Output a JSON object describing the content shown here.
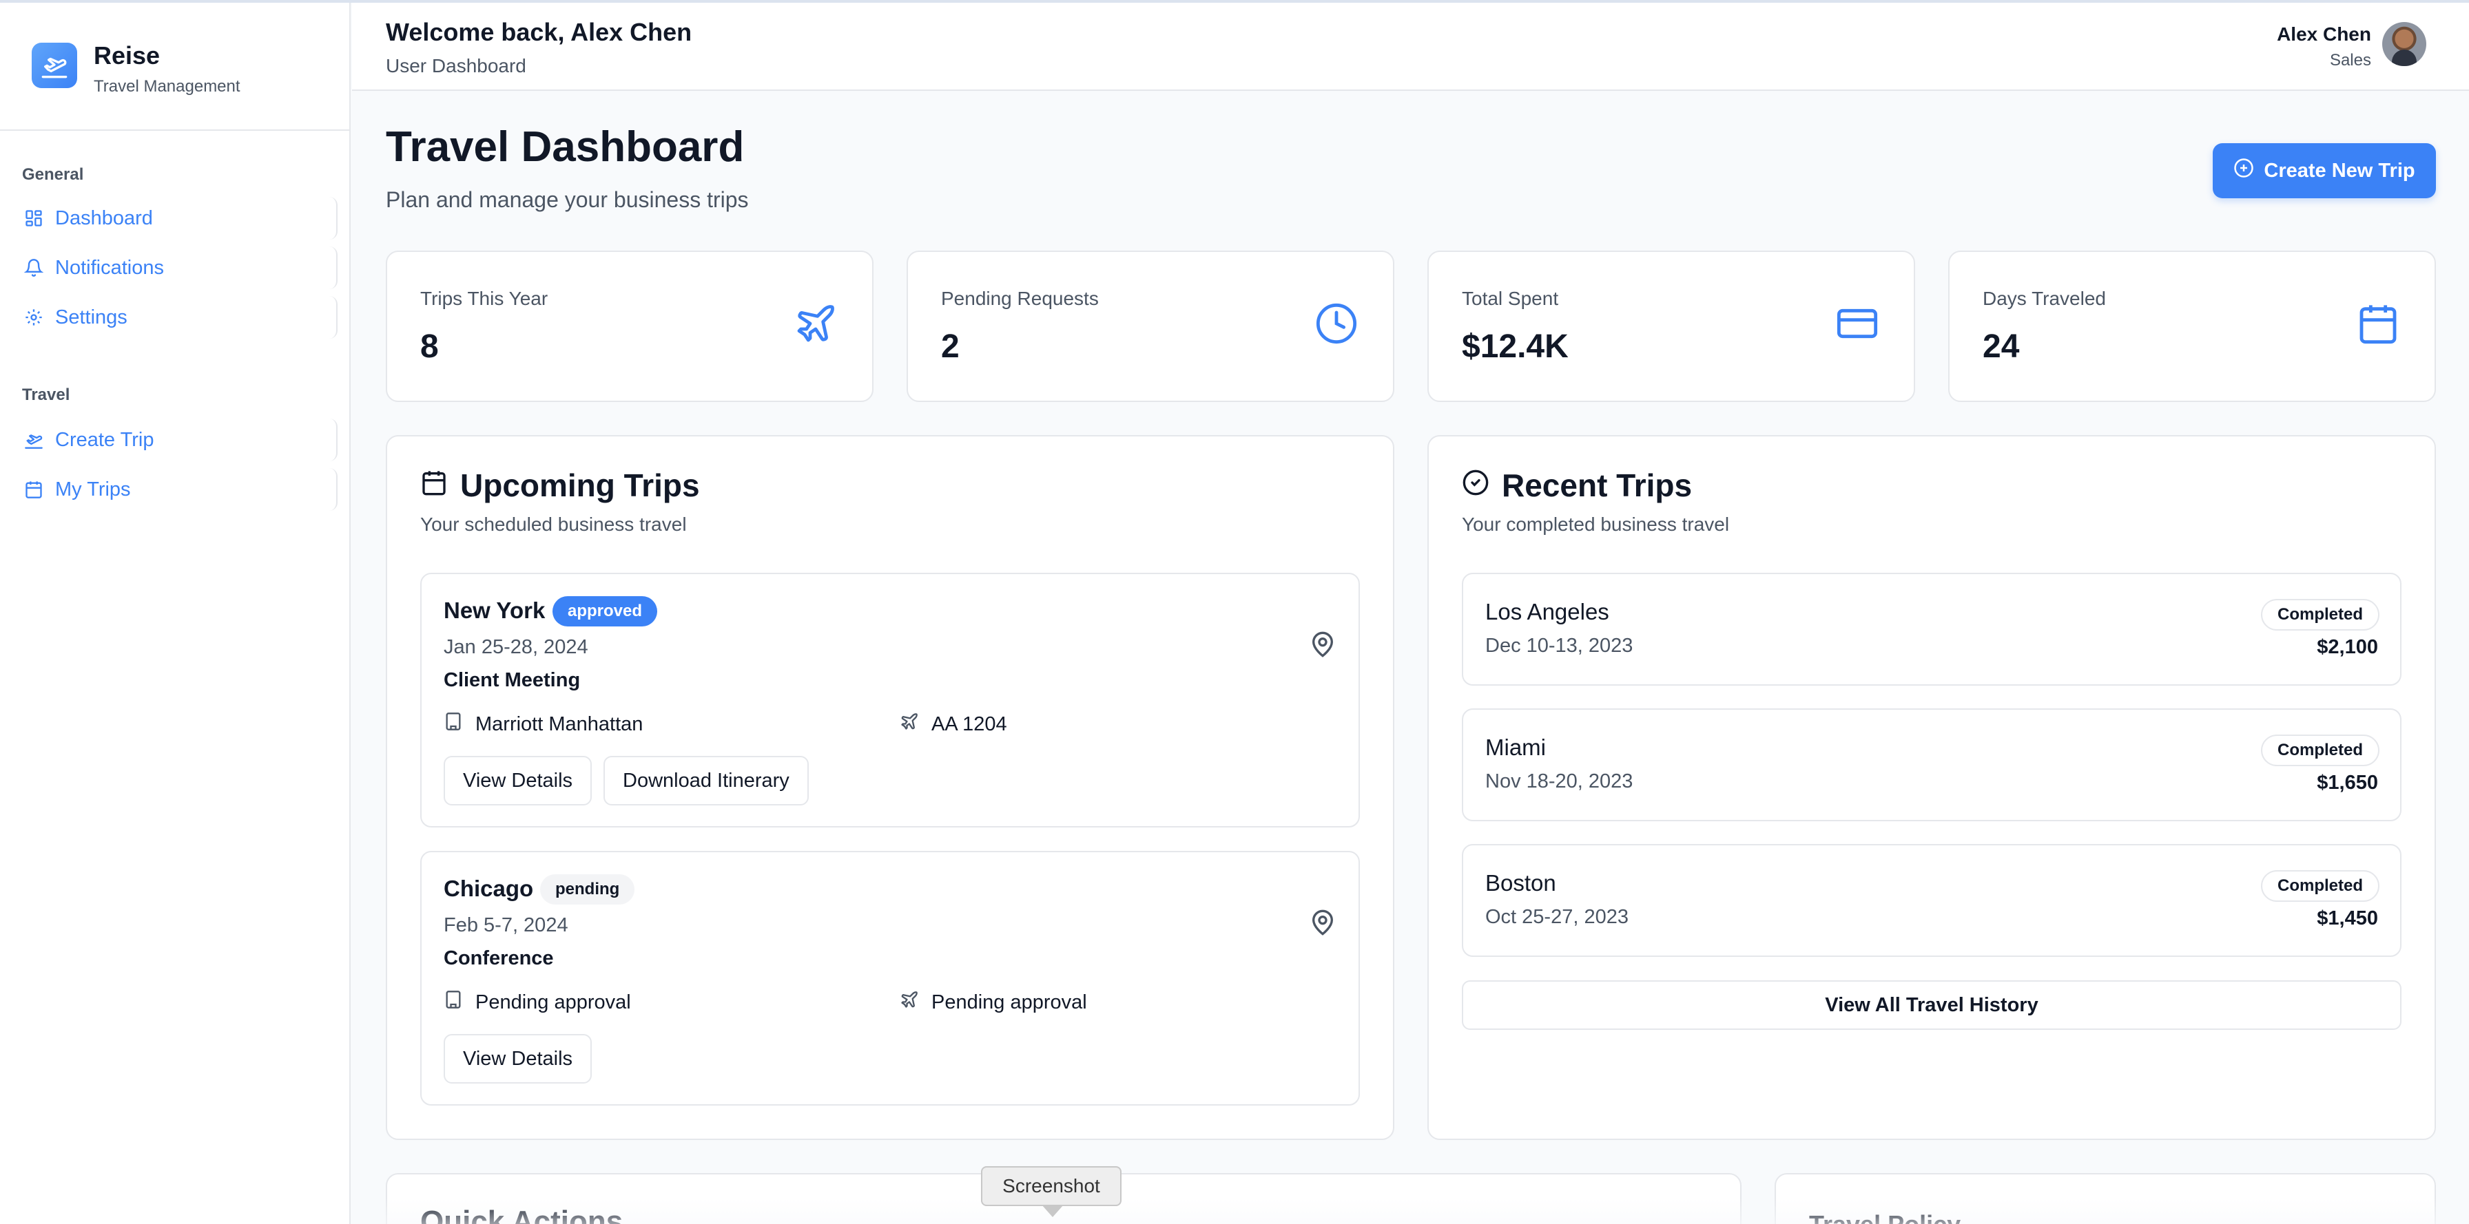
{
  "brand": {
    "name": "Reise",
    "subtitle": "Travel Management"
  },
  "sidebar": {
    "groups": [
      {
        "label": "General",
        "items": [
          {
            "label": "Dashboard",
            "icon": "dashboard-icon"
          },
          {
            "label": "Notifications",
            "icon": "bell-icon"
          },
          {
            "label": "Settings",
            "icon": "gear-icon"
          }
        ]
      },
      {
        "label": "Travel",
        "items": [
          {
            "label": "Create Trip",
            "icon": "plane-takeoff-icon"
          },
          {
            "label": "My Trips",
            "icon": "calendar-icon"
          }
        ]
      }
    ]
  },
  "header": {
    "welcome": "Welcome back, Alex Chen",
    "subtitle": "User Dashboard",
    "user": {
      "name": "Alex Chen",
      "role": "Sales"
    }
  },
  "page": {
    "title": "Travel Dashboard",
    "subtitle": "Plan and manage your business trips",
    "create_button": "Create New Trip"
  },
  "stats": [
    {
      "label": "Trips This Year",
      "value": "8",
      "icon": "plane-icon"
    },
    {
      "label": "Pending Requests",
      "value": "2",
      "icon": "clock-icon"
    },
    {
      "label": "Total Spent",
      "value": "$12.4K",
      "icon": "credit-card-icon"
    },
    {
      "label": "Days Traveled",
      "value": "24",
      "icon": "calendar-icon"
    }
  ],
  "upcoming": {
    "title": "Upcoming Trips",
    "subtitle": "Your scheduled business travel",
    "trips": [
      {
        "city": "New York",
        "status": "approved",
        "dates": "Jan 25-28, 2024",
        "purpose": "Client Meeting",
        "hotel": "Marriott Manhattan",
        "flight": "AA 1204",
        "buttons": [
          "View Details",
          "Download Itinerary"
        ]
      },
      {
        "city": "Chicago",
        "status": "pending",
        "dates": "Feb 5-7, 2024",
        "purpose": "Conference",
        "hotel": "Pending approval",
        "flight": "Pending approval",
        "buttons": [
          "View Details"
        ]
      }
    ]
  },
  "recent": {
    "title": "Recent Trips",
    "subtitle": "Your completed business travel",
    "trips": [
      {
        "city": "Los Angeles",
        "dates": "Dec 10-13, 2023",
        "status": "Completed",
        "amount": "$2,100"
      },
      {
        "city": "Miami",
        "dates": "Nov 18-20, 2023",
        "status": "Completed",
        "amount": "$1,650"
      },
      {
        "city": "Boston",
        "dates": "Oct 25-27, 2023",
        "status": "Completed",
        "amount": "$1,450"
      }
    ],
    "history_button": "View All Travel History"
  },
  "bottom": {
    "quick_actions": "Quick Actions",
    "travel_policy": "Travel Policy"
  },
  "tooltip": "Screenshot",
  "colors": {
    "accent": "#3b82f6",
    "text": "#111827",
    "muted": "#4b5563",
    "border": "#e5e7eb",
    "background": "#f8fafc"
  }
}
